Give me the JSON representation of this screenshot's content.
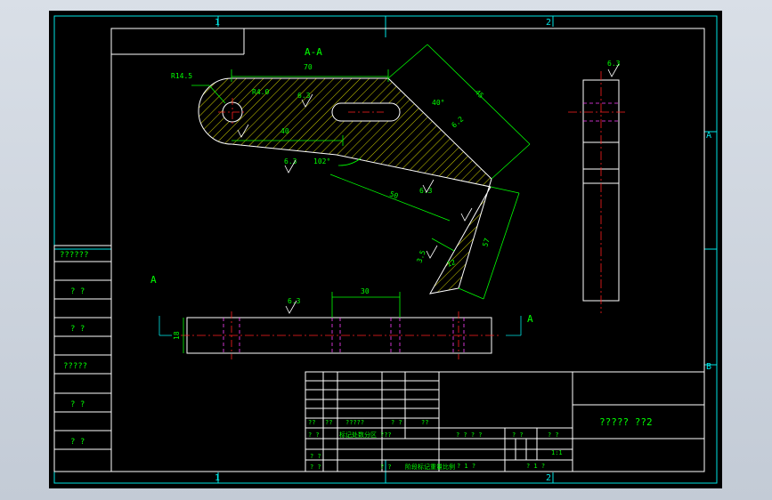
{
  "colors": {
    "background": "#000000",
    "frame": "#00e5e5",
    "outline": "#ffffff",
    "dimension": "#00ff00",
    "centerline": "#ff2020",
    "hidden_line": "#ff40ff",
    "hatch": "#e8e800",
    "text": "#00ff00",
    "paper_surround": "#cfd6df"
  },
  "border": {
    "zone_top_left": "1",
    "zone_top_right": "2",
    "zone_bottom_left": "1",
    "zone_bottom_right": "2",
    "zone_right_upper": "A",
    "zone_right_lower": "B"
  },
  "drawing": {
    "section_label": "A-A",
    "view_arrow_left": "A",
    "view_arrow_right": "A",
    "dims": {
      "r14_5": "R14.5",
      "r4_0": "R4.0",
      "len_70": "70",
      "len_40": "40",
      "angle_40deg": "40°",
      "len_45": "45",
      "angle_102": "102°",
      "len_50": "50",
      "len_57": "57",
      "len_12": "12",
      "len_3_5": "3.5",
      "len_30": "30",
      "len_18": "18",
      "d6_2": "6.2"
    },
    "roughness": {
      "top_right_view": "6.3",
      "center_bar": "6.3",
      "bottom_left": "6.3",
      "mid_lower": "6.3",
      "bottom_view": "6.3"
    }
  },
  "left_strip": {
    "cells": [
      "??????",
      "? ?",
      "? ?",
      "?????",
      "? ?",
      "? ?"
    ]
  },
  "title_block": {
    "title": "????? ??2",
    "row_a": [
      "??",
      "??",
      "?????",
      "? ?",
      "??"
    ],
    "row_b": [
      "? ?",
      "标记处数分区",
      "???"
    ],
    "row_c": [
      "? ?"
    ],
    "row_d": [
      "? ?",
      "? ?",
      "阶段标记重量比例"
    ],
    "info": {
      "stage_label": "? ? ? ?",
      "weight_label": "? ?",
      "scale_label": "? ?",
      "scale_value": "1:1",
      "sheet_total": "? 1 ?",
      "sheet_no": "? 1 ?"
    }
  }
}
